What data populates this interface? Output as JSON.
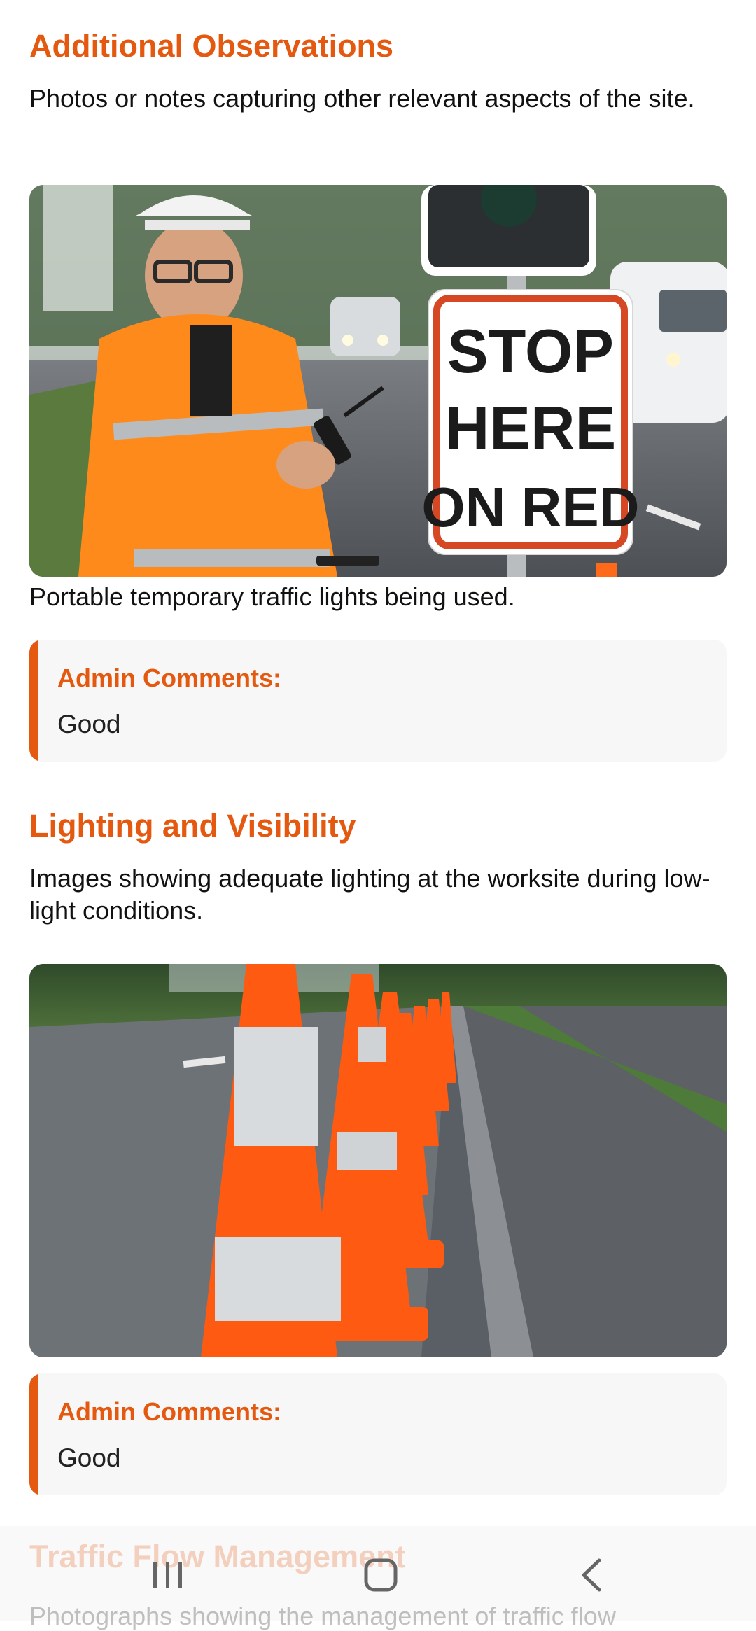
{
  "sections": [
    {
      "title": "Additional Observations",
      "description": "Photos or notes capturing other relevant aspects of the site.",
      "photo_caption": "Portable temporary traffic lights being used.",
      "sign_text": [
        "STOP",
        "HERE",
        "ON RED"
      ],
      "admin_label": "Admin Comments:",
      "admin_value": "Good"
    },
    {
      "title": "Lighting and Visibility",
      "description": "Images showing adequate lighting at the worksite during low-light conditions.",
      "admin_label": "Admin Comments:",
      "admin_value": "Good"
    },
    {
      "title": "Traffic Flow Management",
      "description": "Photographs showing the management of traffic flow"
    }
  ],
  "navbar": {
    "recent_icon": "recent-apps-icon",
    "home_icon": "home-icon",
    "back_icon": "back-icon"
  },
  "colors": {
    "accent": "#E4590F",
    "comment_bg": "#F7F7F7"
  }
}
